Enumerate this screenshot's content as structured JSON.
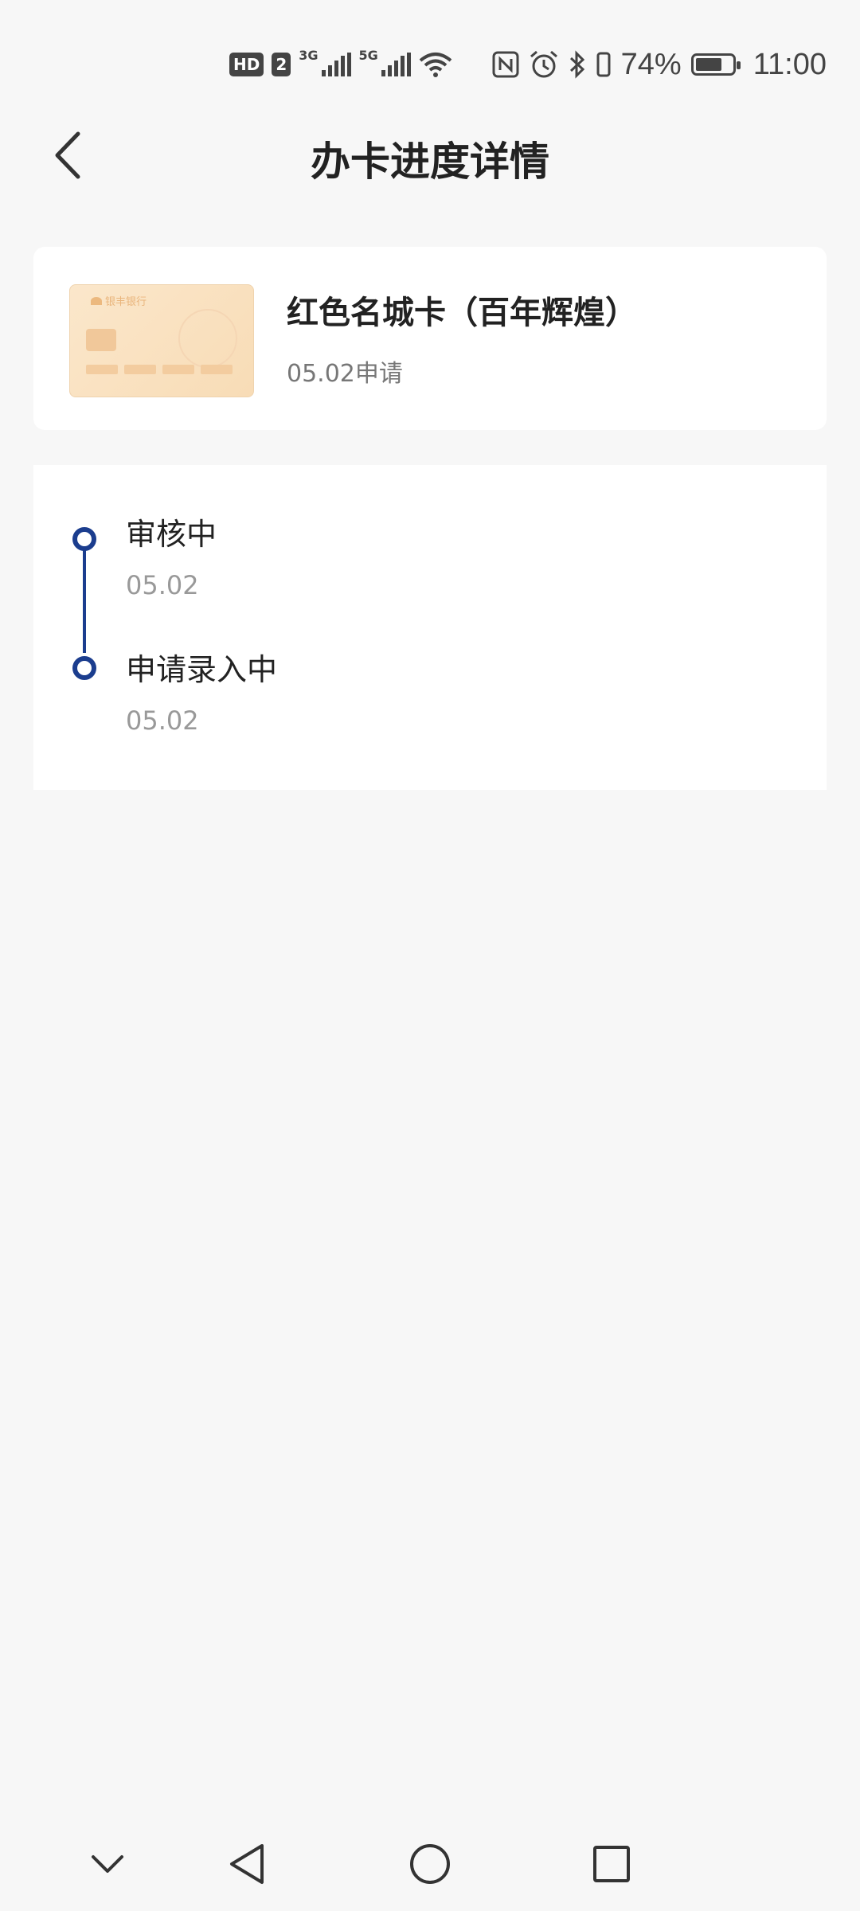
{
  "status_bar": {
    "hd_label": "HD",
    "sim_label": "2",
    "net1": "3G",
    "net2": "5G",
    "battery_text": "74%",
    "battery_level": 0.74,
    "time": "11:00",
    "icons": [
      "nfc-icon",
      "alarm-icon",
      "bluetooth-icon",
      "vibrate-icon",
      "battery-icon",
      "wifi-icon",
      "signal-icon"
    ]
  },
  "header": {
    "title": "办卡进度详情",
    "back_icon": "chevron-left-icon"
  },
  "card": {
    "name": "红色名城卡（百年辉煌）",
    "apply_date": "05.02申请",
    "bank_logo_text": "银丰银行"
  },
  "timeline": {
    "steps": [
      {
        "title": "审核中",
        "date": "05.02"
      },
      {
        "title": "申请录入中",
        "date": "05.02"
      }
    ],
    "accent_color": "#1b3d8e"
  },
  "nav_bar": {
    "buttons": [
      "collapse-icon",
      "back-triangle-icon",
      "home-circle-icon",
      "recent-square-icon"
    ]
  }
}
